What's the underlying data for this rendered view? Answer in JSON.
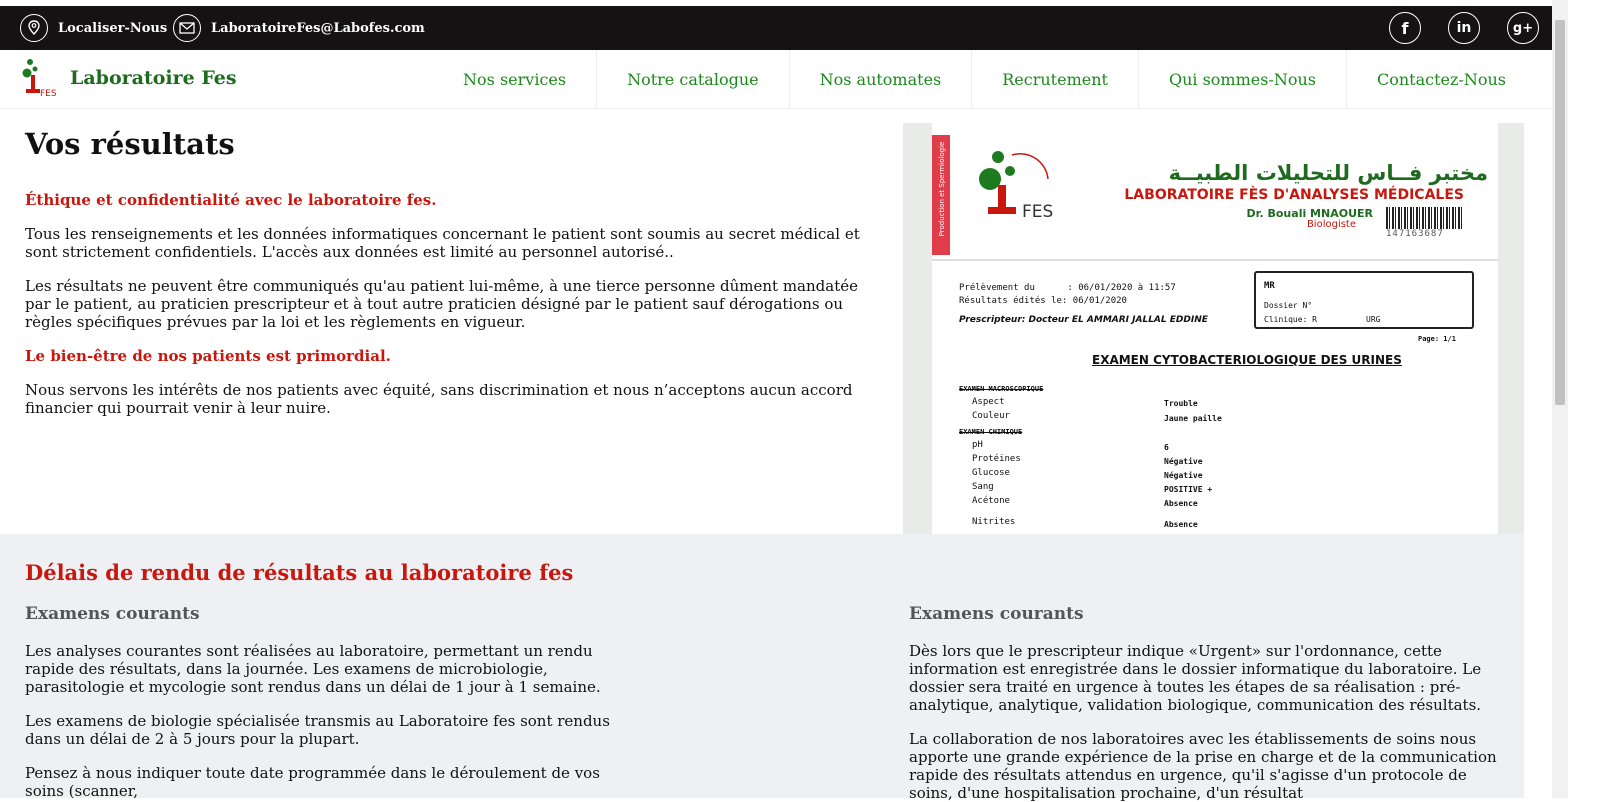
{
  "topbar": {
    "locate_label": "Localiser-Nous",
    "email": "LaboratoireFes@Labofes.com",
    "social": [
      "facebook-icon",
      "linkedin-icon",
      "google-plus-icon"
    ]
  },
  "brand": {
    "name": "Laboratoire Fes",
    "logo_text": "FES"
  },
  "nav": [
    "Nos services",
    "Notre catalogue",
    "Nos automates",
    "Recrutement",
    "Qui sommes-Nous",
    "Contactez-Nous"
  ],
  "results": {
    "title": "Vos résultats",
    "ethics_heading": "Éthique et confidentialité avec le laboratoire fes.",
    "p1": "Tous les renseignements et les données informatiques concernant le patient sont soumis au secret médical et sont strictement confidentiels. L'accès aux données est limité au personnel autorisé..",
    "p2": "Les résultats ne peuvent être communiqués qu'au patient lui-même, à une tierce personne dûment mandatée par le patient, au praticien prescripteur et à tout autre praticien désigné par le patient sauf dérogations ou règles spécifiques prévues par la loi et les règlements en vigueur.",
    "wellbeing_heading": "Le bien-être de nos patients est primordial.",
    "p3": "Nous servons les intérêts de nos patients avec équité, sans discrimination et nous n’acceptons aucun accord financier qui pourrait venir à leur nuire."
  },
  "report": {
    "side_label": "Production et Spermiologie",
    "arabic_name": "مختبر فــاس للتحليلات الطبيــة",
    "lab_name": "LABORATOIRE FÈS D'ANALYSES MÉDICALES",
    "doctor": "Dr. Bouali MNAOUER",
    "role": "Biologiste",
    "barcode": "147163687",
    "prelevement": "Prélèvement du      : 06/01/2020 à 11:57",
    "resultats": "Résultats édités le: 06/01/2020",
    "prescripteur": "Prescripteur: Docteur EL AMMARI JALLAL EDDINE",
    "patient": "MR",
    "dossier": "Dossier N°",
    "clinique": "Clinique: R",
    "clinique_code": "URG",
    "page": "Page: 1/1",
    "exam_title": "EXAMEN CYTOBACTERIOLOGIQUE DES URINES",
    "sections": [
      {
        "name": "EXAMEN MACROSCOPIQUE",
        "rows": [
          [
            "Aspect",
            "Trouble"
          ],
          [
            "Couleur",
            "Jaune paille"
          ]
        ]
      },
      {
        "name": "EXAMEN CHIMIQUE",
        "rows": [
          [
            "pH",
            "6"
          ],
          [
            "Protéines",
            "Négative"
          ],
          [
            "Glucose",
            "Négative"
          ],
          [
            "Sang",
            "POSITIVE +"
          ],
          [
            "Acétone",
            "Absence"
          ],
          [
            "Nitrites",
            "Absence"
          ]
        ]
      }
    ]
  },
  "delays": {
    "title": "Délais de rendu de résultats au laboratoire fes",
    "left": {
      "heading": "Examens courants",
      "p1": "Les analyses courantes sont réalisées au laboratoire, permettant un rendu rapide des résultats, dans la journée. Les examens de microbiologie, parasitologie et mycologie sont rendus dans un délai de 1 jour à 1 semaine.",
      "p2": "Les examens de biologie spécialisée transmis au Laboratoire fes sont rendus dans un délai de 2 à 5 jours pour la plupart.",
      "p3": "Pensez à nous indiquer toute date programmée dans le déroulement de vos soins (scanner,"
    },
    "right": {
      "heading": "Examens courants",
      "p1": "Dès lors que le prescripteur indique «Urgent» sur l'ordonnance, cette information est enregistrée dans le dossier informatique du laboratoire. Le dossier sera traité en urgence à toutes les étapes de sa réalisation : pré-analytique, analytique, validation biologique, communication des résultats.",
      "p2": "La collaboration de nos laboratoires avec les établissements de soins nous apporte une grande expérience de la prise en charge et de la communication rapide des résultats attendus en urgence, qu'il s'agisse d'un protocole de soins, d'une hospitalisation prochaine, d'un résultat"
    }
  }
}
